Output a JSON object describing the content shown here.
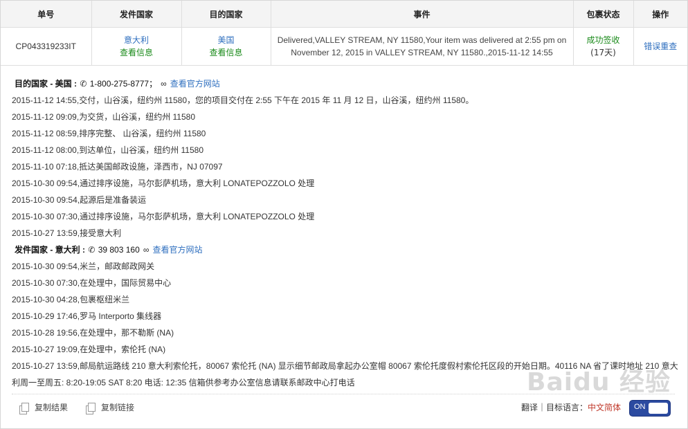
{
  "table": {
    "headers": [
      "单号",
      "发件国家",
      "目的国家",
      "事件",
      "包裹状态",
      "操作"
    ],
    "row": {
      "tracking_no": "CP043319233IT",
      "origin": {
        "country": "意大利",
        "link": "查看信息"
      },
      "destination": {
        "country": "美国",
        "link": "查看信息"
      },
      "event_line1": "Delivered,VALLEY STREAM, NY 11580,Your item was delivered at 2:55 pm on",
      "event_line2": "November 12, 2015 in VALLEY STREAM, NY 11580.,2015-11-12 14:55",
      "status": "成功签收",
      "status_days": "(17天)",
      "action": "错误重查"
    }
  },
  "dest_section": {
    "label": "目的国家 - 美国 :",
    "phone": "1-800-275-8777；",
    "official_link": "查看官方网站",
    "events": [
      "2015-11-12 14:55,交付，山谷溪，纽约州 11580，您的项目交付在 2:55 下午在 2015 年 11 月 12 日，山谷溪，纽约州 11580。",
      "2015-11-12 09:09,为交货，山谷溪，纽约州 11580",
      "2015-11-12 08:59,排序完整、 山谷溪，纽约州 11580",
      "2015-11-12 08:00,到达单位，山谷溪，纽约州 11580",
      "2015-11-10 07:18,抵达美国邮政设施，泽西市，NJ 07097",
      "2015-10-30 09:54,通过排序设施，马尔彭萨机场，意大利 LONATEPOZZOLO 处理",
      "2015-10-30 09:54,起源后是准备装运",
      "2015-10-30 07:30,通过排序设施，马尔彭萨机场，意大利 LONATEPOZZOLO 处理",
      "2015-10-27 13:59,接受意大利"
    ]
  },
  "origin_section": {
    "label": "发件国家 - 意大利 :",
    "phone": "39 803 160",
    "official_link": "查看官方网站",
    "events": [
      "2015-10-30 09:54,米兰，邮政邮政网关",
      "2015-10-30 07:30,在处理中，国际贸易中心",
      "2015-10-30 04:28,包裹枢纽米兰",
      "2015-10-29 17:46,罗马 Interporto 集线器",
      "2015-10-28 19:56,在处理中，那不勒斯 (NA)",
      "2015-10-27 19:09,在处理中，索伦托 (NA)",
      "2015-10-27 13:59,邮局航运路线 210 意大利索伦托，80067 索伦托 (NA) 显示细节邮政局拿起办公室帽 80067 索伦托度假村索伦托区段的开始日期。40116 NA 省了课时地址 210 意大利周一至周五: 8:20-19:05 SAT 8:20 电话: 12:35 信箱供参考办公室信息请联系邮政中心打电话"
    ]
  },
  "footer": {
    "copy_result": "复制结果",
    "copy_link": "复制链接",
    "translate_label": "翻译｜目标语言：",
    "translate_lang": "中文简体",
    "toggle_text": "ON"
  },
  "watermark": "Baidu 经验",
  "colors": {
    "link": "#2f6fbf",
    "success": "#1a8a1a",
    "toggle": "#2b4aa0"
  }
}
